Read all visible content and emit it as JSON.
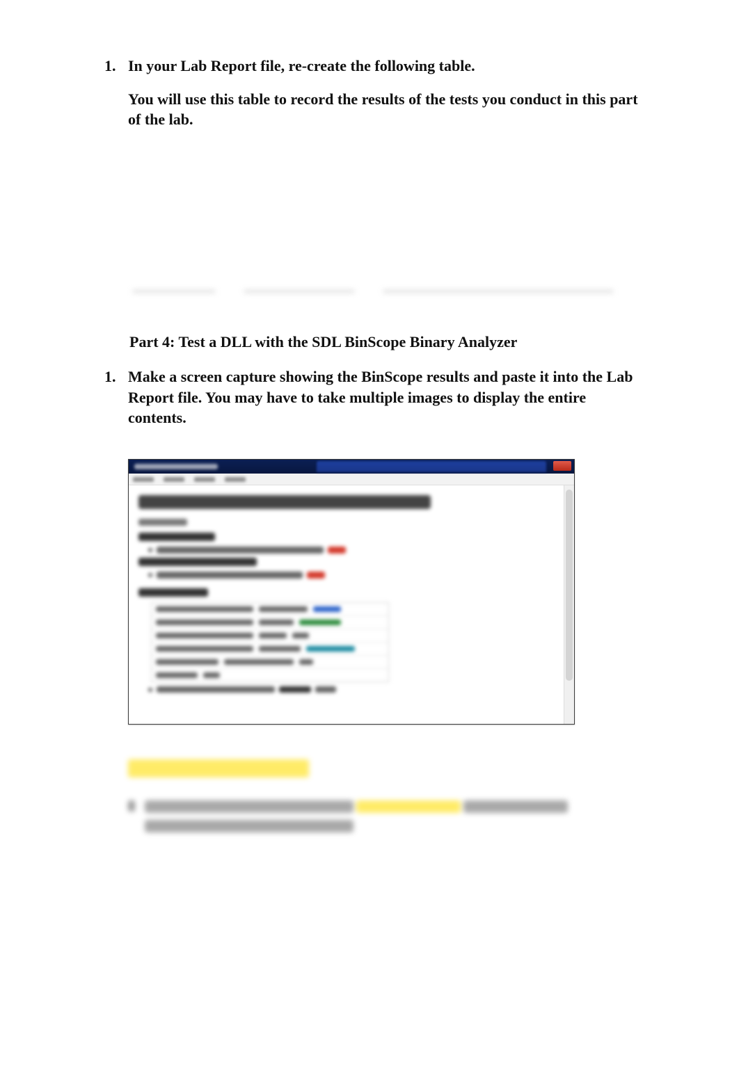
{
  "part3": {
    "items": [
      {
        "num": "1.",
        "lines": [
          "In your Lab Report file, re-create the following table.",
          "You will use this table to record the results of the tests you conduct in this part of the lab."
        ]
      }
    ]
  },
  "part4": {
    "heading": "Part 4: Test a DLL with the SDL BinScope Binary Analyzer",
    "items": [
      {
        "num": "1.",
        "lines": [
          "Make a screen capture showing the BinScope results and paste it into the Lab Report file. You may have to take multiple images to display the entire contents."
        ]
      }
    ]
  },
  "screenshot": {
    "window_close_label": "×"
  }
}
